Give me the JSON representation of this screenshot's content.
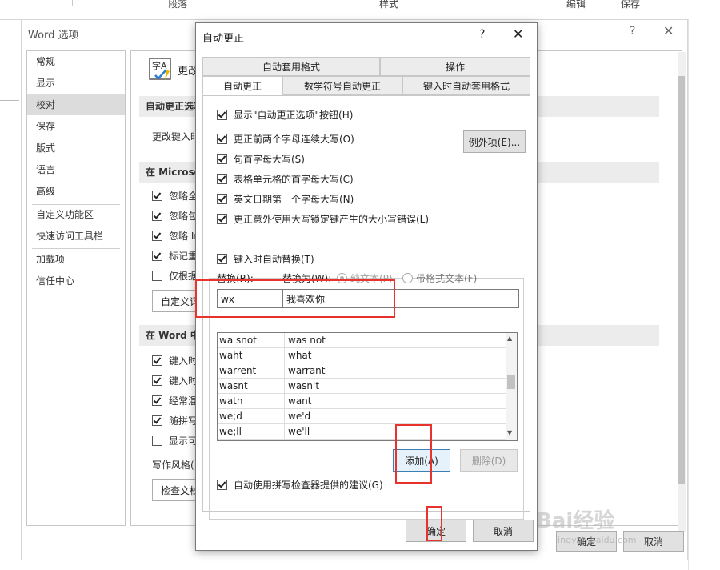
{
  "ribbon": {
    "groups": [
      "段落",
      "样式",
      "编辑",
      "保存"
    ]
  },
  "options_window": {
    "title": "Word 选项",
    "help": "?",
    "close": "✕",
    "nav": [
      "常规",
      "显示",
      "校对",
      "保存",
      "版式",
      "语言",
      "高级",
      "自定义功能区",
      "快速访问工具栏",
      "加载项",
      "信任中心"
    ],
    "selected_nav": "校对",
    "header_text": "更改",
    "section1": "自动更正选项",
    "section1_row": "更改键入时",
    "section2": "在 Microso",
    "section2_rows": [
      "忽略全",
      "忽略包",
      "忽略 In",
      "标记重",
      "仅根据"
    ],
    "section2_checks": [
      true,
      true,
      true,
      true,
      false
    ],
    "custom_dict_btn": "自定义词",
    "section3": "在 Word 中",
    "section3_rows": [
      "键入时",
      "键入时",
      "经常混",
      "随拼写",
      "显示可"
    ],
    "section3_checks": [
      true,
      true,
      true,
      true,
      false
    ],
    "writing_style": "写作风格(",
    "check_doc_btn": "检查文档",
    "ok": "确定",
    "cancel": "取消"
  },
  "dialog": {
    "title": "自动更正",
    "help": "?",
    "close": "✕",
    "tabs_row1": [
      "自动套用格式",
      "操作"
    ],
    "tabs_row2": [
      "自动更正",
      "数学符号自动更正",
      "键入时自动套用格式"
    ],
    "show_options": "显示\"自动更正选项\"按钮(H)",
    "checks": [
      "更正前两个字母连续大写(O)",
      "句首字母大写(S)",
      "表格单元格的首字母大写(C)",
      "英文日期第一个字母大写(N)",
      "更正意外使用大写锁定键产生的大小写错误(L)"
    ],
    "exceptions_btn": "例外项(E)...",
    "replace_as_typed": "键入时自动替换(T)",
    "replace_label": "替换(R):",
    "with_label": "替换为(W):",
    "plain_text": "纯文本(P)",
    "formatted_text": "带格式文本(F)",
    "replace_value": "wx",
    "with_value": "我喜欢你",
    "list": [
      [
        "wa snot",
        "was not"
      ],
      [
        "waht",
        "what"
      ],
      [
        "warrent",
        "warrant"
      ],
      [
        "wasnt",
        "wasn't"
      ],
      [
        "watn",
        "want"
      ],
      [
        "we;d",
        "we'd"
      ],
      [
        "we;ll",
        "we'll"
      ]
    ],
    "add_btn": "添加(A)",
    "delete_btn": "删除(D)",
    "spell_suggest": "自动使用拼写检查器提供的建议(G)",
    "ok": "确定",
    "cancel": "取消"
  },
  "watermark": {
    "brand": "Bai经验",
    "url": "jingyan.baidu.com"
  },
  "colors": {
    "highlight": "#e8322c",
    "selected_nav": "#dcdcdc",
    "add_button_border": "#3c7fb1"
  }
}
